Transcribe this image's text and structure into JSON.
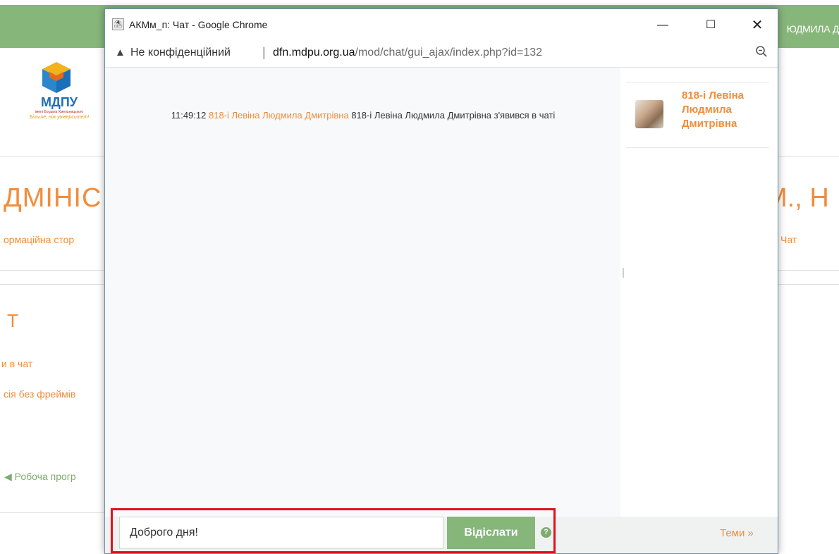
{
  "background": {
    "user_name": "ЮДМИЛА Д",
    "logo": {
      "title": "МДПУ",
      "subtitle": "імені Богдана Хмельницького",
      "tagline": "Більше, ніж університет!"
    },
    "page_title_left": "ДМІНІС",
    "page_title_right": "М., Н",
    "breadcrumb_left": "ормаційна стор",
    "breadcrumb_right": "Чат",
    "section_heading": "Т",
    "link_enter_chat": "и в чат",
    "link_no_frames": "сія без фреймів",
    "prev_activity": "◀ Робоча прогр"
  },
  "window": {
    "title": "АКМм_п: Чат - Google Chrome",
    "minimize_glyph": "—",
    "maximize_glyph": "☐",
    "close_glyph": "✕"
  },
  "address_bar": {
    "security_icon": "warning-triangle-icon",
    "security_label": "Не конфіденційний",
    "separator": "|",
    "url_host": "dfn.mdpu.org.ua",
    "url_path": "/mod/chat/gui_ajax/index.php?id=132"
  },
  "chat": {
    "messages": [
      {
        "time": "11:49:12",
        "user": "818-і Левіна Людмила Дмитрівна",
        "text": "818-і Левіна Людмила Дмитрівна з'явився в чаті"
      }
    ]
  },
  "users_panel": {
    "users": [
      {
        "name": "818-і Левіна Людмила Дмитрівна"
      }
    ]
  },
  "composer": {
    "input_value": "Доброго дня!",
    "send_label": "Відіслати",
    "help_glyph": "?",
    "themes_label": "Теми »"
  },
  "colors": {
    "accent_green": "#86b67a",
    "link_orange": "#f28c3a",
    "highlight_red": "#e1111b"
  }
}
